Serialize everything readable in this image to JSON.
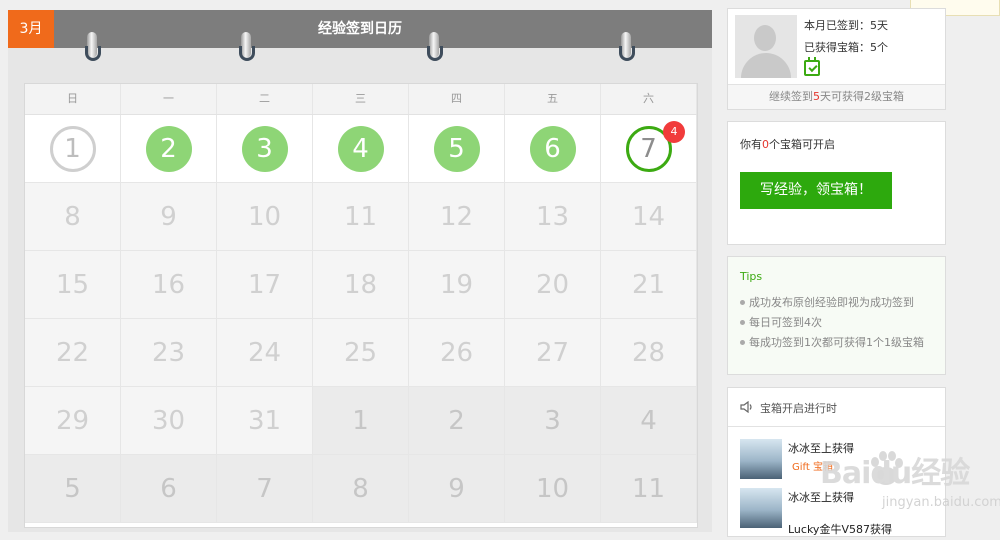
{
  "calendar": {
    "month_tag": "3月",
    "title": "经验签到日历",
    "weekdays": [
      "日",
      "一",
      "二",
      "三",
      "四",
      "五",
      "六"
    ],
    "weeks": [
      [
        {
          "n": "1",
          "style": "gray"
        },
        {
          "n": "2",
          "style": "green"
        },
        {
          "n": "3",
          "style": "green"
        },
        {
          "n": "4",
          "style": "green"
        },
        {
          "n": "5",
          "style": "green"
        },
        {
          "n": "6",
          "style": "green"
        },
        {
          "n": "7",
          "style": "today",
          "badge": "4"
        }
      ],
      [
        {
          "n": "8"
        },
        {
          "n": "9"
        },
        {
          "n": "10"
        },
        {
          "n": "11"
        },
        {
          "n": "12"
        },
        {
          "n": "13"
        },
        {
          "n": "14"
        }
      ],
      [
        {
          "n": "15"
        },
        {
          "n": "16"
        },
        {
          "n": "17"
        },
        {
          "n": "18"
        },
        {
          "n": "19"
        },
        {
          "n": "20"
        },
        {
          "n": "21"
        }
      ],
      [
        {
          "n": "22"
        },
        {
          "n": "23"
        },
        {
          "n": "24"
        },
        {
          "n": "25"
        },
        {
          "n": "26"
        },
        {
          "n": "27"
        },
        {
          "n": "28"
        }
      ],
      [
        {
          "n": "29"
        },
        {
          "n": "30"
        },
        {
          "n": "31"
        },
        {
          "n": "1",
          "other": true
        },
        {
          "n": "2",
          "other": true
        },
        {
          "n": "3",
          "other": true
        },
        {
          "n": "4",
          "other": true
        }
      ],
      [
        {
          "n": "5",
          "other": true
        },
        {
          "n": "6",
          "other": true
        },
        {
          "n": "7",
          "other": true
        },
        {
          "n": "8",
          "other": true
        },
        {
          "n": "9",
          "other": true
        },
        {
          "n": "10",
          "other": true
        },
        {
          "n": "11",
          "other": true
        }
      ]
    ]
  },
  "profile": {
    "signed_label": "本月已签到：",
    "signed_value": "5天",
    "boxes_label": "已获得宝箱：",
    "boxes_value": "5个",
    "footer_pre": "继续签到",
    "footer_num": "5",
    "footer_post": "天可获得2级宝箱"
  },
  "treasure": {
    "text_pre": "你有",
    "count": "0",
    "text_post": "个宝箱可开启",
    "button": "写经验，领宝箱！"
  },
  "tips": {
    "title": "Tips",
    "items": [
      "成功发布原创经验即视为成功签到",
      "每日可签到4次",
      "每成功签到1次都可获得1个1级宝箱"
    ]
  },
  "feed": {
    "title": "宝箱开启进行时",
    "items": [
      {
        "name": "冰冰至上获得",
        "sub": "Gift 宝箱"
      },
      {
        "name": "冰冰至上获得",
        "sub": ""
      },
      {
        "name": "Lucky金牛V587获得",
        "sub": ""
      }
    ]
  },
  "watermark": {
    "text": "Baidu经验",
    "sub": "jingyan.baidu.com"
  },
  "colors": {
    "orange": "#f06a1b",
    "green": "#3caa12",
    "light_green": "#8ed576",
    "red": "#f13b3b"
  }
}
